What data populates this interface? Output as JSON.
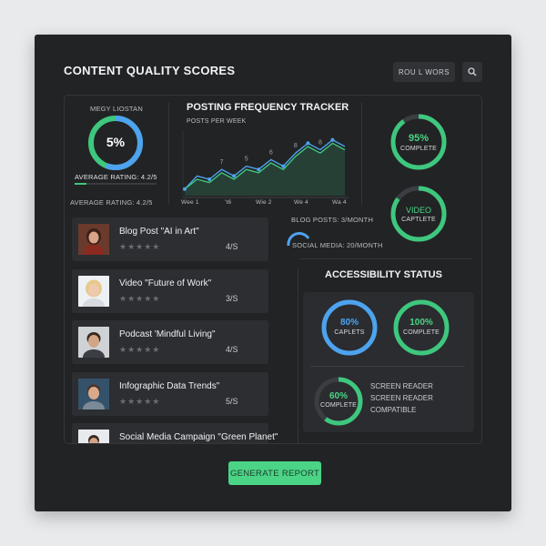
{
  "header": {
    "title": "CONTENT QUALITY SCORES",
    "top_button": "ROU L WORS"
  },
  "rating_widget": {
    "label": "MEGY LIOSTAN",
    "score": "5%",
    "average_text": "AVERAGE RATING: 4.2/5",
    "average_text_2": "AVERAGE RATING: 4.2/5",
    "level": 0.14
  },
  "frequency_tracker": {
    "title": "POSTING FREQUENCY TRACKER",
    "subtitle": "POSTS PER WEEK",
    "blog_posts": "BLOG POSTS: 3/MONTH",
    "social_media": "SOCIAL MEDIA: 20/MONTH"
  },
  "chart_data": {
    "type": "line",
    "title": "POSTING FREQUENCY TRACKER",
    "xlabel": "",
    "ylabel": "POSTS PER WEEK",
    "x_tick_labels": [
      "Wee 1",
      "'t6",
      "Wie 2",
      "We 4",
      "Wa 4"
    ],
    "series": [
      {
        "values": [
          1,
          3,
          2.5,
          4,
          3,
          4.5,
          4,
          5.5,
          4.5,
          6.5,
          8,
          7,
          8.5,
          7.5
        ],
        "color": "#4da3ef"
      },
      {
        "values": [
          1,
          2.5,
          2,
          3.5,
          2.5,
          4,
          3.5,
          5,
          4,
          6,
          7.5,
          6.5,
          8,
          7
        ],
        "color": "#3ec77e"
      }
    ],
    "data_labels": [
      "7",
      "5",
      "6",
      "8",
      "8"
    ],
    "grid": false,
    "ylim": [
      0,
      10
    ]
  },
  "right_rings": [
    {
      "value_text": "95%",
      "label": "COMPLETE",
      "fill": 0.9
    },
    {
      "value_text": "VIDEO",
      "label": "CAPTLETE",
      "fill": 0.85
    }
  ],
  "accessibility": {
    "title": "ACCESSIBILITY STATUS",
    "rings": [
      {
        "value_text": "80%",
        "label": "CAPLETS",
        "fill": 1.0,
        "color": "#4da3ef"
      },
      {
        "value_text": "100%",
        "label": "COMPLETE",
        "fill": 1.0,
        "color": "#3ec77e"
      },
      {
        "value_text": "60%",
        "label": "COMPLETE",
        "fill": 0.6,
        "color": "#3ec77e"
      }
    ],
    "lines": [
      "SCREEN READER",
      "SCREEN READER",
      "COMPATIBLE"
    ]
  },
  "content_list": [
    {
      "title": "Blog Post \"AI in Art\"",
      "stars": "★★★★★",
      "score": "4/S"
    },
    {
      "title": "Video \"Future of Work\"",
      "stars": "★★★★★",
      "score": "3/S"
    },
    {
      "title": "Podcast 'Mindful Living\"",
      "stars": "★★★★★",
      "score": "4/S"
    },
    {
      "title": "Infographic Data Trends\"",
      "stars": "★★★★★",
      "score": "5/S"
    },
    {
      "title": "Social Media Campaign \"Green Planet\"",
      "stars": "",
      "score": ""
    }
  ],
  "footer": {
    "generate_button": "GENERATE REPORT"
  },
  "colors": {
    "accent_green": "#4bd486",
    "accent_blue": "#4da3ef",
    "panel_bg": "#222325"
  }
}
